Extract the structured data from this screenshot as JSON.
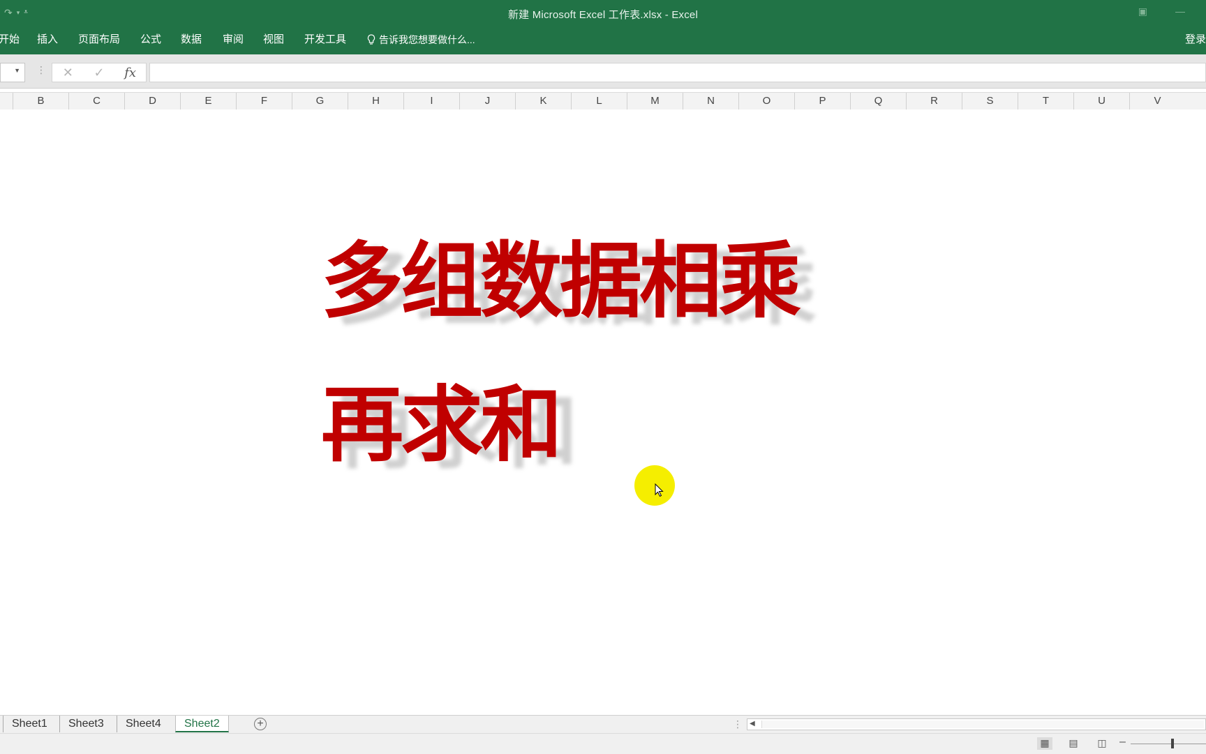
{
  "window": {
    "title": "新建 Microsoft Excel 工作表.xlsx - Excel"
  },
  "quick_access": {
    "icons": [
      "redo-icon",
      "dropdown-icon",
      "customize-icon"
    ]
  },
  "ribbon": {
    "tabs": [
      {
        "label": "开始"
      },
      {
        "label": "插入"
      },
      {
        "label": "页面布局"
      },
      {
        "label": "公式"
      },
      {
        "label": "数据"
      },
      {
        "label": "审阅"
      },
      {
        "label": "视图"
      },
      {
        "label": "开发工具"
      }
    ],
    "tell_me": "告诉我您想要做什么...",
    "signin": "登录"
  },
  "formula_bar": {
    "cancel_symbol": "✕",
    "enter_symbol": "✓",
    "fx_label": "fx",
    "value": ""
  },
  "columns": [
    "B",
    "C",
    "D",
    "E",
    "F",
    "G",
    "H",
    "I",
    "J",
    "K",
    "L",
    "M",
    "N",
    "O",
    "P",
    "Q",
    "R",
    "S",
    "T",
    "U",
    "V"
  ],
  "sheet_content": {
    "line1": "多组数据相乘",
    "line2": "再求和",
    "text_color": "#c00000"
  },
  "sheet_tabs": [
    {
      "label": "Sheet1",
      "active": false
    },
    {
      "label": "Sheet3",
      "active": false
    },
    {
      "label": "Sheet4",
      "active": false
    },
    {
      "label": "Sheet2",
      "active": true
    }
  ],
  "status_bar": {
    "view_buttons": [
      "normal-view-icon",
      "page-layout-view-icon",
      "page-break-view-icon"
    ]
  },
  "colors": {
    "excel_green": "#217346",
    "cursor_highlight": "#f5ee00"
  }
}
